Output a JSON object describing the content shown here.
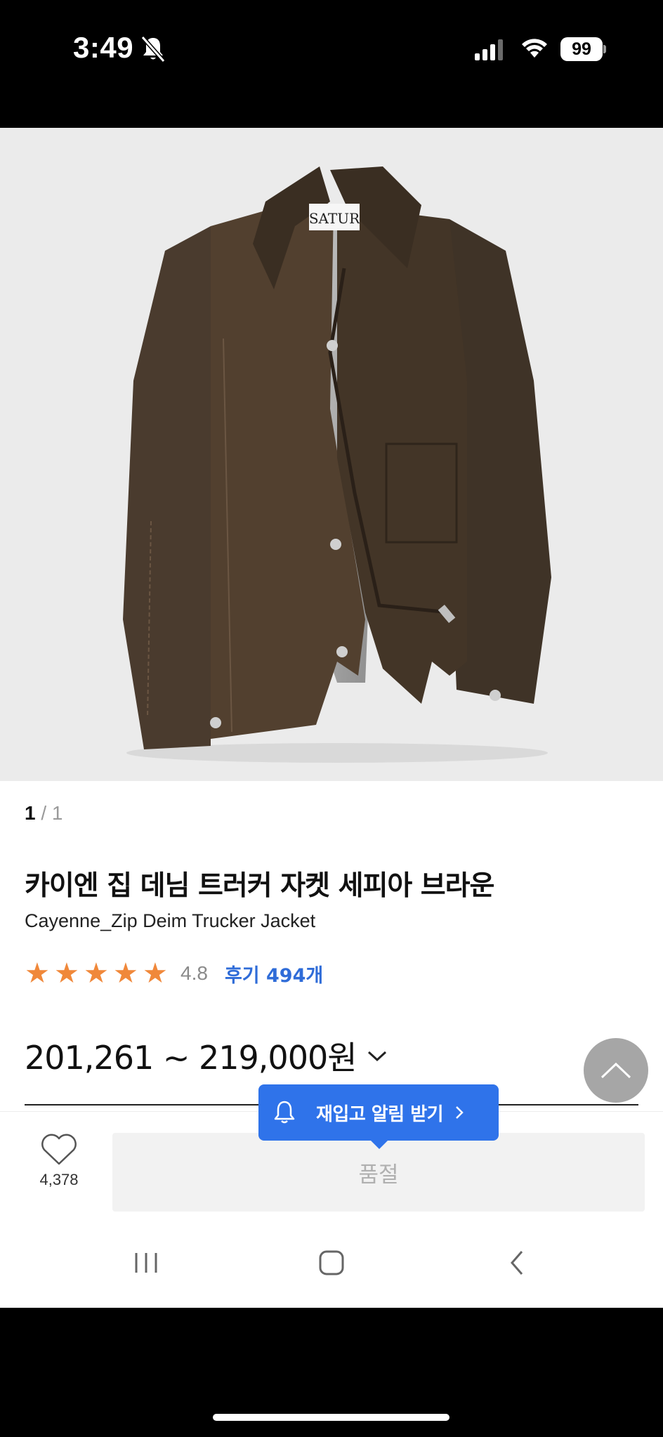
{
  "status_bar": {
    "time": "3:49",
    "battery_level": "99"
  },
  "product": {
    "image_counter": {
      "current": "1",
      "separator": "/",
      "total": "1"
    },
    "label_text": "SATUR",
    "title": "카이엔 집 데님 트러커 자켓 세피아 브라운",
    "subtitle": "Cayenne_Zip Deim Trucker Jacket",
    "rating": {
      "stars": 5,
      "value": "4.8",
      "reviews_label": "후기 494개"
    },
    "price_range": "201,261 ~ 219,000원"
  },
  "bottom_bar": {
    "like_count": "4,378",
    "soldout_label": "품절",
    "restock_label": "재입고 알림 받기"
  },
  "colors": {
    "accent": "#2f73ea",
    "star": "#f0883a",
    "review_link": "#2f6cd8"
  }
}
